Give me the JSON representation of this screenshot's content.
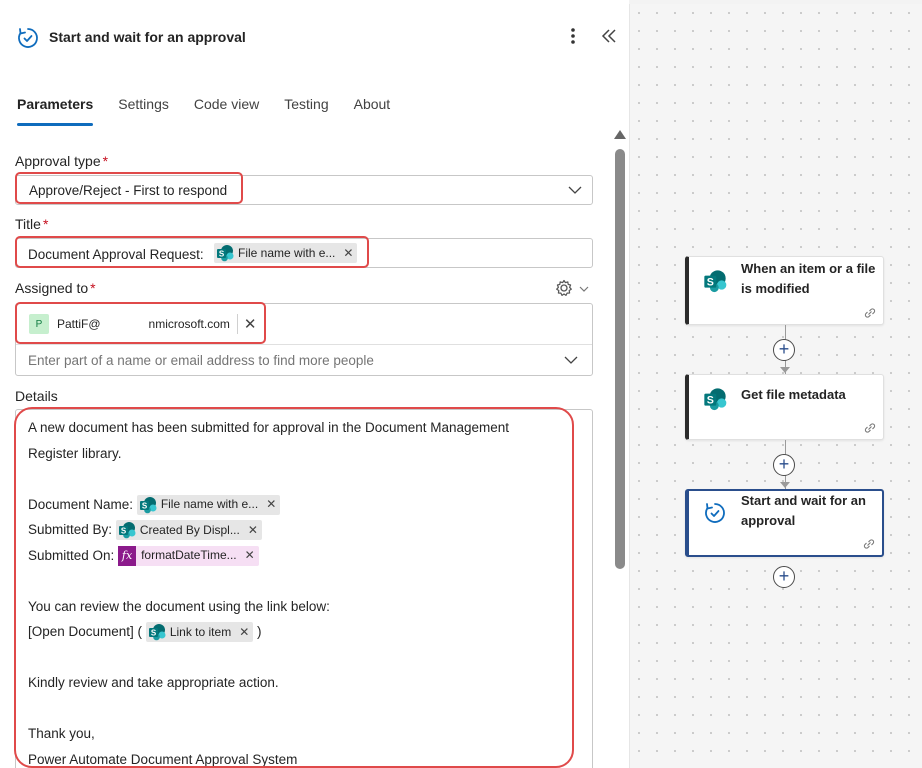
{
  "header": {
    "title": "Start and wait for an approval",
    "icon": "approval-icon",
    "more_icon": "more-vertical-icon",
    "collapse_icon": "double-chevron-left-icon"
  },
  "tabs": [
    {
      "label": "Parameters",
      "active": true
    },
    {
      "label": "Settings",
      "active": false
    },
    {
      "label": "Code view",
      "active": false
    },
    {
      "label": "Testing",
      "active": false
    },
    {
      "label": "About",
      "active": false
    }
  ],
  "fields": {
    "approval_type": {
      "label": "Approval type",
      "required": "*",
      "value": "Approve/Reject - First to respond"
    },
    "title": {
      "label": "Title",
      "required": "*",
      "prefix": "Document Approval Request:",
      "token": "File name with e..."
    },
    "assigned_to": {
      "label": "Assigned to",
      "required": "*",
      "person_initial": "P",
      "person_email": "PattiF@    nmicrosoft.com",
      "placeholder": "Enter part of a name or email address to find more people"
    },
    "details": {
      "label": "Details",
      "line1": "A new document has been submitted for approval in the Document Management",
      "line2": "Register library.",
      "doc_name_label": "Document Name:",
      "doc_name_token": "File name with e...",
      "submitted_by_label": "Submitted By:",
      "submitted_by_token": "Created By Displ...",
      "submitted_on_label": "Submitted On:",
      "submitted_on_token": "formatDateTime...",
      "review_line": "You can review the document using the link below:",
      "open_doc_prefix": "[Open Document] (",
      "link_token": "Link to item",
      "open_doc_suffix": ")",
      "kindly_line": "Kindly review and take appropriate action.",
      "thanks_line": "Thank you,",
      "signature_line": "Power Automate Document Approval System"
    }
  },
  "flow": {
    "steps": [
      {
        "title": "When an item or a file is modified",
        "icon": "sharepoint-icon"
      },
      {
        "title": "Get file metadata",
        "icon": "sharepoint-icon"
      },
      {
        "title": "Start and wait for an approval",
        "icon": "approval-icon",
        "selected": true
      }
    ],
    "plus_label": "+"
  },
  "colors": {
    "accent": "#0f6cbd",
    "highlight": "#e04a4a",
    "sharepoint": "#038387",
    "fx": "#8b1a8b",
    "selected_border": "#2a4e8c"
  }
}
